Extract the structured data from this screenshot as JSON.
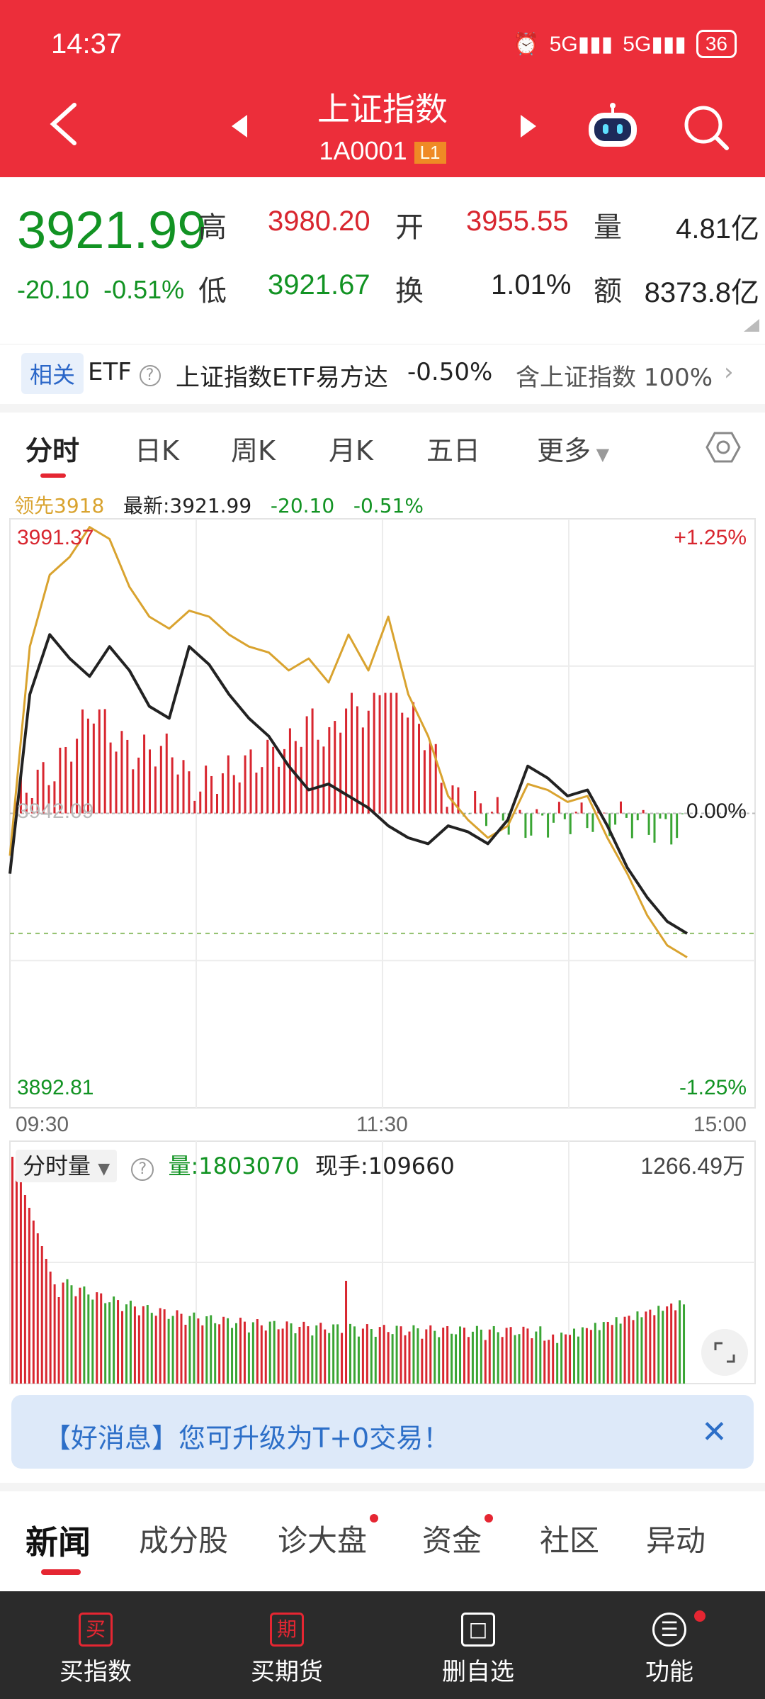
{
  "status": {
    "time": "14:37",
    "signal1": "5G",
    "signal2": "5G",
    "battery": "36"
  },
  "header": {
    "title": "上证指数",
    "code": "1A0001",
    "level_badge": "L1"
  },
  "quote": {
    "price": "3921.99",
    "change": "-20.10",
    "change_pct": "-0.51%",
    "high_label": "高",
    "high": "3980.20",
    "open_label": "开",
    "open": "3955.55",
    "volume_label": "量",
    "volume": "4.81亿",
    "low_label": "低",
    "low": "3921.67",
    "turnover_label": "换",
    "turnover": "1.01%",
    "amount_label": "额",
    "amount": "8373.8亿"
  },
  "related": {
    "badge": "相关",
    "type": "ETF",
    "name": "上证指数ETF易方达",
    "pct": "-0.50%",
    "desc": "含上证指数 100%"
  },
  "tabs": [
    "分时",
    "日K",
    "周K",
    "月K",
    "五日",
    "更多"
  ],
  "legend": {
    "leader": "领先3918",
    "latest": "最新:3921.99",
    "change": "-20.10",
    "pct": "-0.51%"
  },
  "axis": {
    "y_top": "3991.37",
    "y_mid": "3942.09",
    "y_bottom": "3892.81",
    "pct_top": "+1.25%",
    "pct_mid": "0.00%",
    "pct_bottom": "-1.25%",
    "x_start": "09:30",
    "x_mid": "11:30",
    "x_end": "15:00"
  },
  "volume_panel": {
    "dropdown": "分时量",
    "volume": "量:1803070",
    "current": "现手:109660",
    "max": "1266.49万"
  },
  "banner": {
    "text": "【好消息】您可升级为T+0交易！"
  },
  "news_tabs": [
    "新闻",
    "成分股",
    "诊大盘",
    "资金",
    "社区",
    "异动"
  ],
  "bottom_nav": [
    {
      "icon": "买",
      "label": "买指数"
    },
    {
      "icon": "期",
      "label": "买期货"
    },
    {
      "icon": "□",
      "label": "删自选"
    },
    {
      "icon": "☰",
      "label": "功能"
    }
  ],
  "colors": {
    "header": "#ec2e3a",
    "up": "#d8262f",
    "down": "#129323",
    "price_line": "#222222",
    "leader_line": "#d9a32f"
  },
  "chart_data": {
    "type": "line",
    "x_range": [
      "09:30",
      "15:00"
    ],
    "ylim": [
      3892.81,
      3991.37
    ],
    "baseline": 3942.09,
    "series": [
      {
        "name": "最新",
        "values": [
          3932,
          3962,
          3972,
          3968,
          3965,
          3970,
          3966,
          3960,
          3958,
          3970,
          3967,
          3962,
          3958,
          3955,
          3950,
          3946,
          3947,
          3945,
          3943,
          3940,
          3938,
          3937,
          3940,
          3939,
          3937,
          3941,
          3950,
          3948,
          3945,
          3946,
          3940,
          3933,
          3928,
          3924,
          3921.99
        ]
      },
      {
        "name": "领先",
        "values": [
          3935,
          3970,
          3982,
          3985,
          3990,
          3988,
          3980,
          3975,
          3973,
          3976,
          3975,
          3972,
          3970,
          3969,
          3966,
          3968,
          3964,
          3972,
          3966,
          3975,
          3962,
          3955,
          3945,
          3941,
          3938,
          3940,
          3947,
          3946,
          3944,
          3945,
          3938,
          3932,
          3925,
          3920,
          3918
        ]
      }
    ],
    "dashed_level": 3922
  }
}
